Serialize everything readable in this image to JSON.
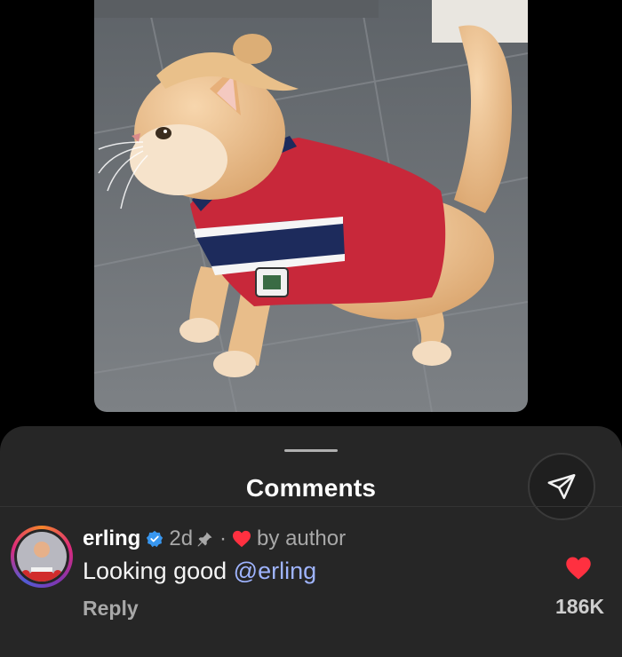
{
  "post": {
    "image_alt": "Ginger cat with a top-knot wearing a red, white and navy striped jersey"
  },
  "comments_sheet": {
    "title": "Comments",
    "share_icon": "send-icon"
  },
  "comment": {
    "username": "erling",
    "verified_icon": "verified-badge-icon",
    "time": "2d",
    "pin_icon": "pin-icon",
    "separator": "·",
    "author_like_icon": "heart-icon",
    "author_like_text": "by author",
    "text_prefix": "Looking good ",
    "mention": "@erling",
    "reply_label": "Reply",
    "like_icon": "heart-icon",
    "like_count": "186K"
  },
  "colors": {
    "heart": "#ff3040",
    "verified": "#3897f0",
    "mention": "#9fb4ff",
    "sheet_bg": "#262626"
  }
}
